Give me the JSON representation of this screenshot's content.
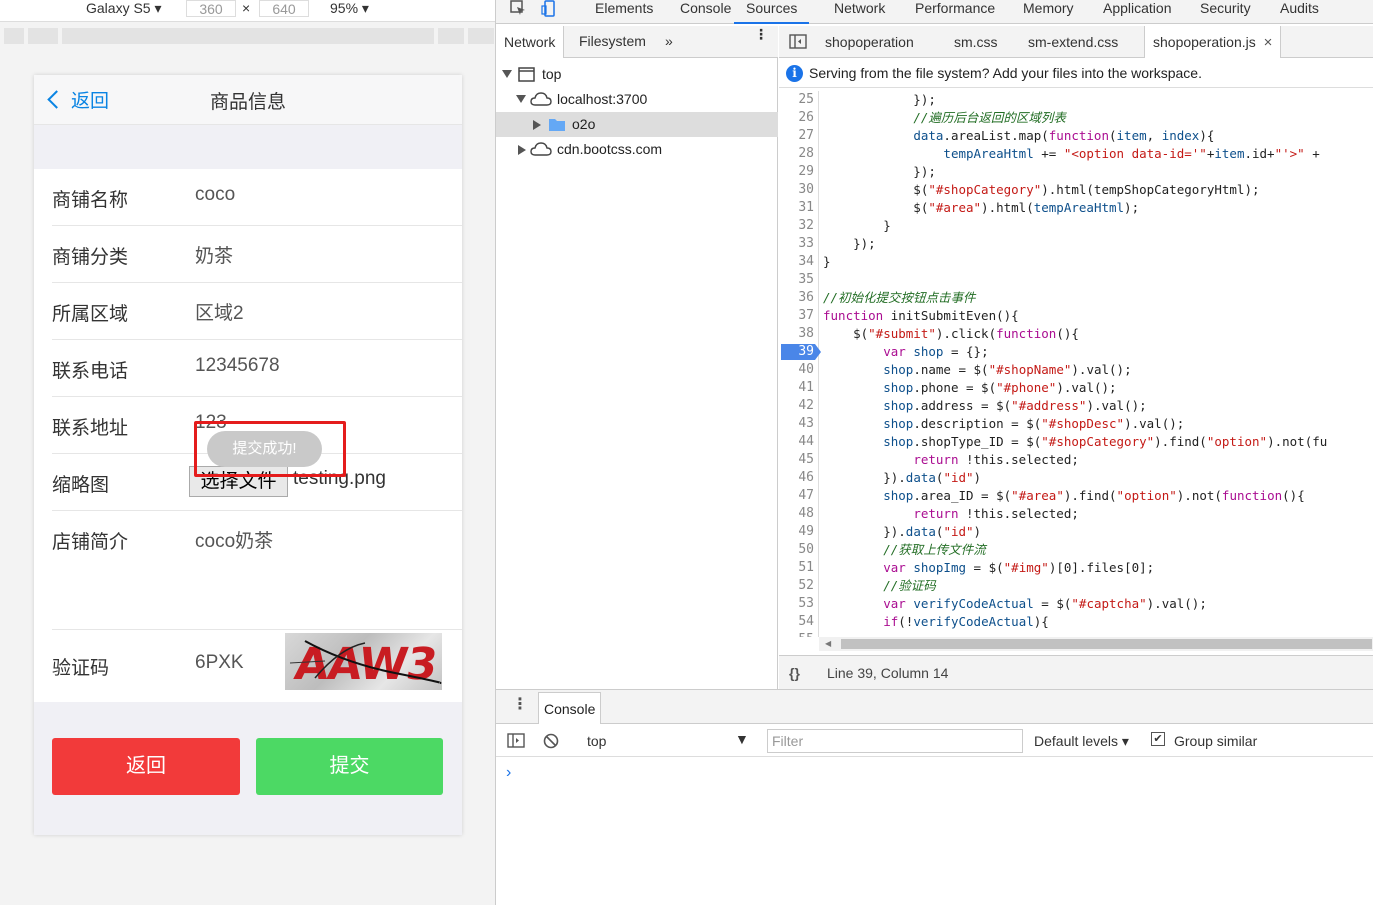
{
  "device_toolbar": {
    "device": "Galaxy S5",
    "width": "360",
    "times": "×",
    "height": "640",
    "zoom": "95%"
  },
  "phone": {
    "back_label": "返回",
    "title": "商品信息",
    "fields": [
      {
        "label": "商铺名称",
        "value": "coco"
      },
      {
        "label": "商铺分类",
        "value": "奶茶"
      },
      {
        "label": "所属区域",
        "value": "区域2"
      },
      {
        "label": "联系电话",
        "value": "12345678"
      },
      {
        "label": "联系地址",
        "value": "123"
      },
      {
        "label": "缩略图",
        "value": ""
      },
      {
        "label": "店铺简介",
        "value": "coco奶茶"
      },
      {
        "label": "验证码",
        "value": "6PXK"
      }
    ],
    "file_button": "选择文件",
    "file_name": "testing.png",
    "captcha_text": "AAW3",
    "toast": "提交成功!",
    "btn_back": "返回",
    "btn_submit": "提交",
    "colors": {
      "back_red": "#f23a3a",
      "submit_green": "#4cd964",
      "link_blue": "#0a84e3"
    }
  },
  "devtools": {
    "tabs": [
      "Elements",
      "Console",
      "Sources",
      "Network",
      "Performance",
      "Memory",
      "Application",
      "Security",
      "Audits"
    ],
    "active_tab": "Sources",
    "nav_tabs": [
      "Network",
      "Filesystem"
    ],
    "nav_more": "»",
    "tree": [
      {
        "label": "top",
        "level": 0
      },
      {
        "label": "localhost:3700",
        "level": 1
      },
      {
        "label": "o2o",
        "level": 2
      },
      {
        "label": "cdn.bootcss.com",
        "level": 1
      }
    ],
    "file_tabs": [
      "shopoperation",
      "sm.css",
      "sm-extend.css",
      "shopoperation.js"
    ],
    "close_glyph": "×",
    "infobar": "Serving from the file system? Add your files into the workspace.",
    "info_glyph": "i",
    "status": "Line 39, Column 14",
    "status_icon": "{}",
    "breakpoint_line": 39,
    "code_lines": [
      {
        "n": "25",
        "t": "            });"
      },
      {
        "n": "26",
        "t": "            //遍历后台返回的区域列表"
      },
      {
        "n": "27",
        "t": "            data.areaList.map(function(item, index){"
      },
      {
        "n": "28",
        "t": "                tempAreaHtml += \"<option data-id='\"+item.id+\"'>\" +"
      },
      {
        "n": "29",
        "t": "            });"
      },
      {
        "n": "30",
        "t": "            $(\"#shopCategory\").html(tempShopCategoryHtml);"
      },
      {
        "n": "31",
        "t": "            $(\"#area\").html(tempAreaHtml);"
      },
      {
        "n": "32",
        "t": "        }"
      },
      {
        "n": "33",
        "t": "    });"
      },
      {
        "n": "34",
        "t": "}"
      },
      {
        "n": "35",
        "t": ""
      },
      {
        "n": "36",
        "t": "//初始化提交按钮点击事件"
      },
      {
        "n": "37",
        "t": "function initSubmitEven(){"
      },
      {
        "n": "38",
        "t": "    $(\"#submit\").click(function(){"
      },
      {
        "n": "39",
        "t": "        var shop = {};"
      },
      {
        "n": "40",
        "t": "        shop.name = $(\"#shopName\").val();"
      },
      {
        "n": "41",
        "t": "        shop.phone = $(\"#phone\").val();"
      },
      {
        "n": "42",
        "t": "        shop.address = $(\"#address\").val();"
      },
      {
        "n": "43",
        "t": "        shop.description = $(\"#shopDesc\").val();"
      },
      {
        "n": "44",
        "t": "        shop.shopType_ID = $(\"#shopCategory\").find(\"option\").not(fu"
      },
      {
        "n": "45",
        "t": "            return !this.selected;"
      },
      {
        "n": "46",
        "t": "        }).data(\"id\")"
      },
      {
        "n": "47",
        "t": "        shop.area_ID = $(\"#area\").find(\"option\").not(function(){"
      },
      {
        "n": "48",
        "t": "            return !this.selected;"
      },
      {
        "n": "49",
        "t": "        }).data(\"id\")"
      },
      {
        "n": "50",
        "t": "        //获取上传文件流"
      },
      {
        "n": "51",
        "t": "        var shopImg = $(\"#img\")[0].files[0];"
      },
      {
        "n": "52",
        "t": "        //验证码"
      },
      {
        "n": "53",
        "t": "        var verifyCodeActual = $(\"#captcha\").val();"
      },
      {
        "n": "54",
        "t": "        if(!verifyCodeActual){"
      },
      {
        "n": "55",
        "t": ""
      }
    ],
    "console": {
      "tab": "Console",
      "context": "top",
      "filter_placeholder": "Filter",
      "levels": "Default levels",
      "group_similar": "Group similar",
      "prompt": "›"
    }
  }
}
